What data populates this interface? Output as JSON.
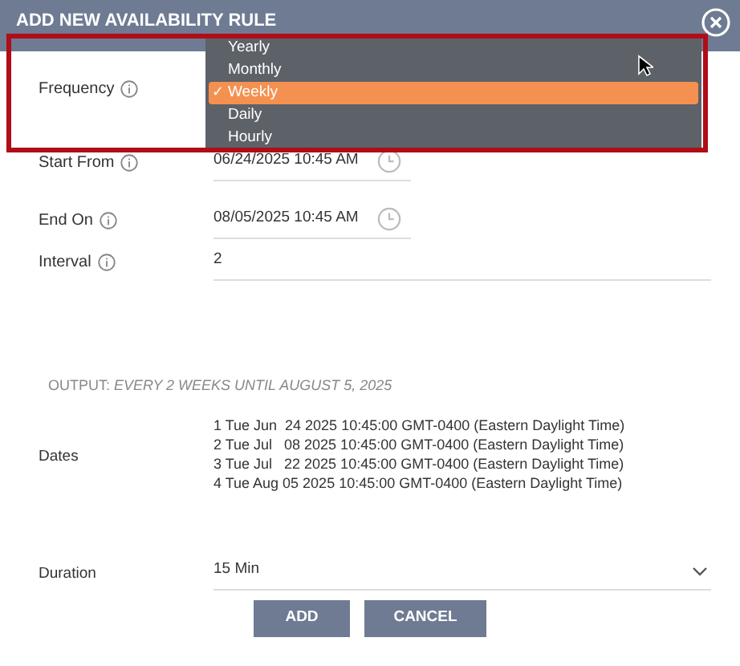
{
  "dialog": {
    "title": "ADD NEW AVAILABILITY RULE"
  },
  "fields": [
    {
      "kind": "select",
      "label": "Frequency",
      "info": true
    },
    {
      "kind": "date",
      "label": "Start From",
      "info": true,
      "value": "06/24/2025 10:45 AM"
    },
    {
      "kind": "date",
      "label": "End On",
      "info": true,
      "value": "08/05/2025 10:45 AM"
    },
    {
      "kind": "text",
      "label": "Interval",
      "info": true,
      "value": "2"
    }
  ],
  "check_mark": "✓",
  "frequency_menu": [
    {
      "label": "Yearly",
      "selected": false
    },
    {
      "label": "Monthly",
      "selected": false
    },
    {
      "label": "Weekly",
      "selected": true
    },
    {
      "label": "Daily",
      "selected": false
    },
    {
      "label": "Hourly",
      "selected": false
    }
  ],
  "output": {
    "label": "OUTPUT:",
    "text": "EVERY 2 WEEKS UNTIL AUGUST 5, 2025"
  },
  "dates": {
    "label": "Dates",
    "lines": [
      "1 Tue Jun  24 2025 10:45:00 GMT-0400 (Eastern Daylight Time)",
      "2 Tue Jul   08 2025 10:45:00 GMT-0400 (Eastern Daylight Time)",
      "3 Tue Jul   22 2025 10:45:00 GMT-0400 (Eastern Daylight Time)",
      "4 Tue Aug 05 2025 10:45:00 GMT-0400 (Eastern Daylight Time)"
    ]
  },
  "duration": {
    "label": "Duration",
    "value": "15 Min"
  },
  "buttons": [
    "ADD",
    "CANCEL"
  ]
}
